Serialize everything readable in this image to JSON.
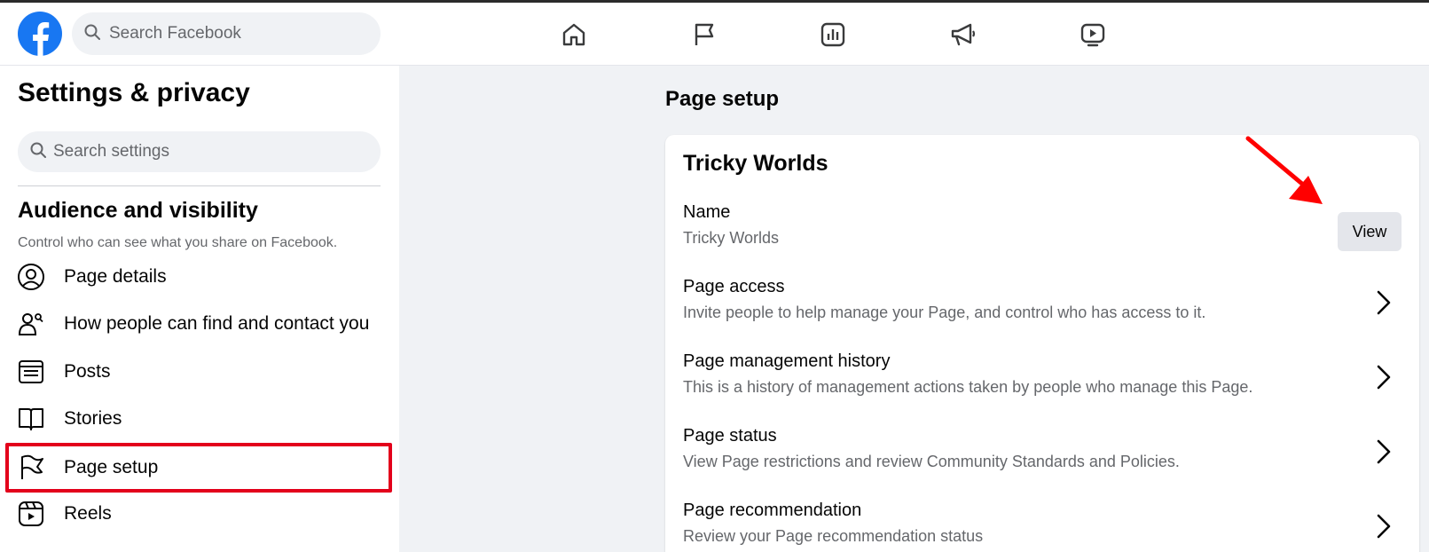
{
  "header": {
    "search_placeholder": "Search Facebook",
    "nav_icons": [
      "home-icon",
      "flag-icon",
      "insights-icon",
      "megaphone-icon",
      "video-icon"
    ]
  },
  "sidebar": {
    "title": "Settings & privacy",
    "search_placeholder": "Search settings",
    "section_title": "Audience and visibility",
    "section_subtitle": "Control who can see what you share on Facebook.",
    "items": [
      {
        "label": "Page details",
        "icon": "person-circle-icon"
      },
      {
        "label": "How people can find and contact you",
        "icon": "people-search-icon"
      },
      {
        "label": "Posts",
        "icon": "posts-icon"
      },
      {
        "label": "Stories",
        "icon": "book-icon"
      },
      {
        "label": "Page setup",
        "icon": "flag-icon",
        "highlighted": true
      },
      {
        "label": "Reels",
        "icon": "reels-icon"
      }
    ]
  },
  "main": {
    "title": "Page setup",
    "card": {
      "page_name": "Tricky Worlds",
      "name_row": {
        "title": "Name",
        "subtitle": "Tricky Worlds",
        "button_label": "View"
      },
      "rows": [
        {
          "title": "Page access",
          "subtitle": "Invite people to help manage your Page, and control who has access to it."
        },
        {
          "title": "Page management history",
          "subtitle": "This is a history of management actions taken by people who manage this Page."
        },
        {
          "title": "Page status",
          "subtitle": "View Page restrictions and review Community Standards and Policies."
        },
        {
          "title": "Page recommendation",
          "subtitle": "Review your Page recommendation status"
        }
      ]
    }
  },
  "colors": {
    "brand": "#1877f2",
    "highlight_box": "#e3001b",
    "annotation_arrow": "#ff0000"
  }
}
